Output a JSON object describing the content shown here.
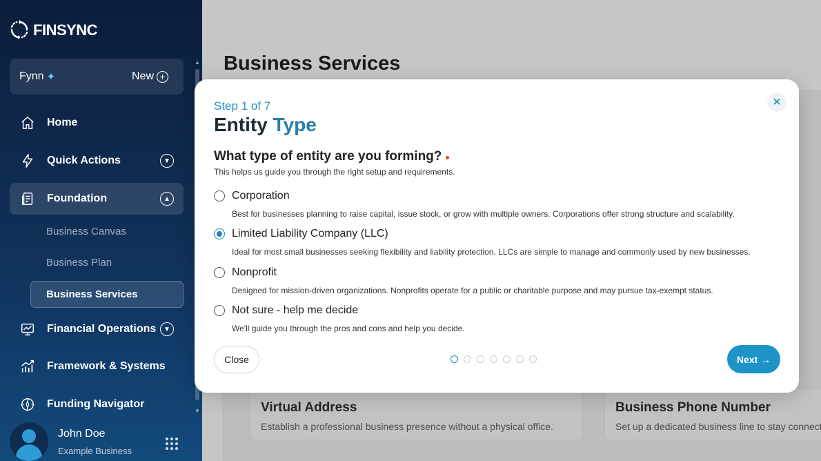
{
  "brand": {
    "name": "FINSYNC"
  },
  "sidebar": {
    "assistant": {
      "name": "Fynn",
      "new_label": "New"
    },
    "nav": [
      {
        "label": "Home",
        "icon": "home-icon"
      },
      {
        "label": "Quick Actions",
        "icon": "lightning-icon"
      },
      {
        "label": "Foundation",
        "icon": "document-icon"
      },
      {
        "label": "Financial Operations",
        "icon": "monitor-chart-icon"
      },
      {
        "label": "Framework & Systems",
        "icon": "growth-chart-icon"
      },
      {
        "label": "Funding Navigator",
        "icon": "compass-icon"
      }
    ],
    "sub": [
      "Business Canvas",
      "Business Plan",
      "Business Services"
    ],
    "user": {
      "name": "John Doe",
      "business": "Example Business"
    }
  },
  "main": {
    "title": "Business Services",
    "cards": [
      {
        "title": "Virtual Address",
        "desc": "Establish a professional business presence without a physical office."
      },
      {
        "title": "Business Phone Number",
        "desc": "Set up a dedicated business line to stay connected"
      }
    ]
  },
  "modal": {
    "step": "Step 1 of 7",
    "title_a": "Entity ",
    "title_b": "Type",
    "question": "What type of entity are you forming?",
    "helper": "This helps us guide you through the right setup and requirements.",
    "options": [
      {
        "label": "Corporation",
        "desc": "Best for businesses planning to raise capital, issue stock, or grow with multiple owners. Corporations offer strong structure and scalability."
      },
      {
        "label": "Limited Liability Company (LLC)",
        "desc": "Ideal for most small businesses seeking flexibility and liability protection. LLCs are simple to manage and commonly used by new businesses."
      },
      {
        "label": "Nonprofit",
        "desc": "Designed for mission-driven organizations. Nonprofits operate for a public or charitable purpose and may pursue tax-exempt status."
      },
      {
        "label": "Not sure - help me decide",
        "desc": "We'll guide you through the pros and cons and help you decide."
      }
    ],
    "selected_option": "Limited Liability Company (LLC)",
    "close_label": "Close",
    "next_label": "Next",
    "total_steps": 7,
    "current_step": 1,
    "accent_color": "#1d93c7"
  }
}
